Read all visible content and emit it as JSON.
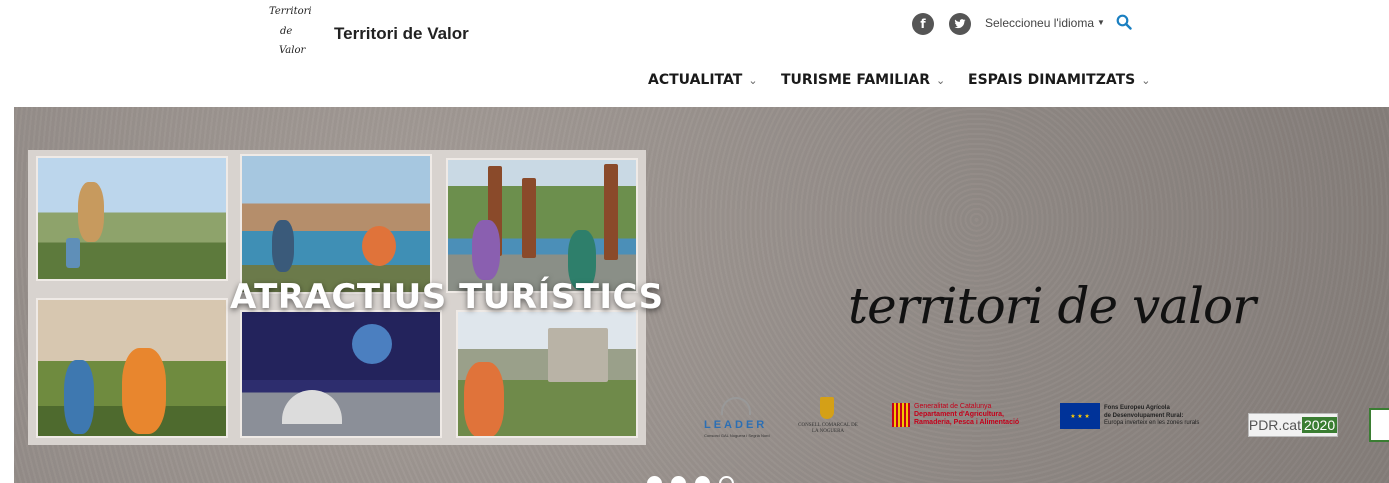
{
  "header": {
    "logo": {
      "line1": "Territori",
      "line2": "de",
      "line3": "Valor"
    },
    "site_title": "Territori de Valor",
    "social": {
      "facebook_glyph": "f",
      "twitter_glyph": "t"
    },
    "language_selector": "Seleccioneu l'idioma",
    "nav": [
      {
        "label": "ACTUALITAT"
      },
      {
        "label": "TURISME FAMILIAR"
      },
      {
        "label": "ESPAIS DINAMITZATS"
      }
    ]
  },
  "hero": {
    "title": "ATRACTIUS TURÍSTICS",
    "brand_script": "territori de valor",
    "sponsors": {
      "leader": "LEADER",
      "leader_sub": "Consorci GAL Noguera i Segrià Nord",
      "consell": "CONSELL COMARCAL DE LA NOGUERA",
      "gencat_line1": "Generalitat de Catalunya",
      "gencat_line2": "Departament d'Agricultura,",
      "gencat_line3": "Ramaderia, Pesca i Alimentació",
      "eu_line1": "Fons Europeu Agrícola",
      "eu_line2": "de Desenvolupament Rural:",
      "eu_line3": "Europa inverteix en les zones rurals",
      "pdr_prefix": "PDR.cat",
      "pdr_year": "2020"
    },
    "carousel": {
      "slide_count": 4,
      "active_index": 3
    }
  },
  "colors": {
    "accent_search": "#1a7fc1",
    "social_bg": "#555555",
    "hero_bg": "#8f8884"
  }
}
